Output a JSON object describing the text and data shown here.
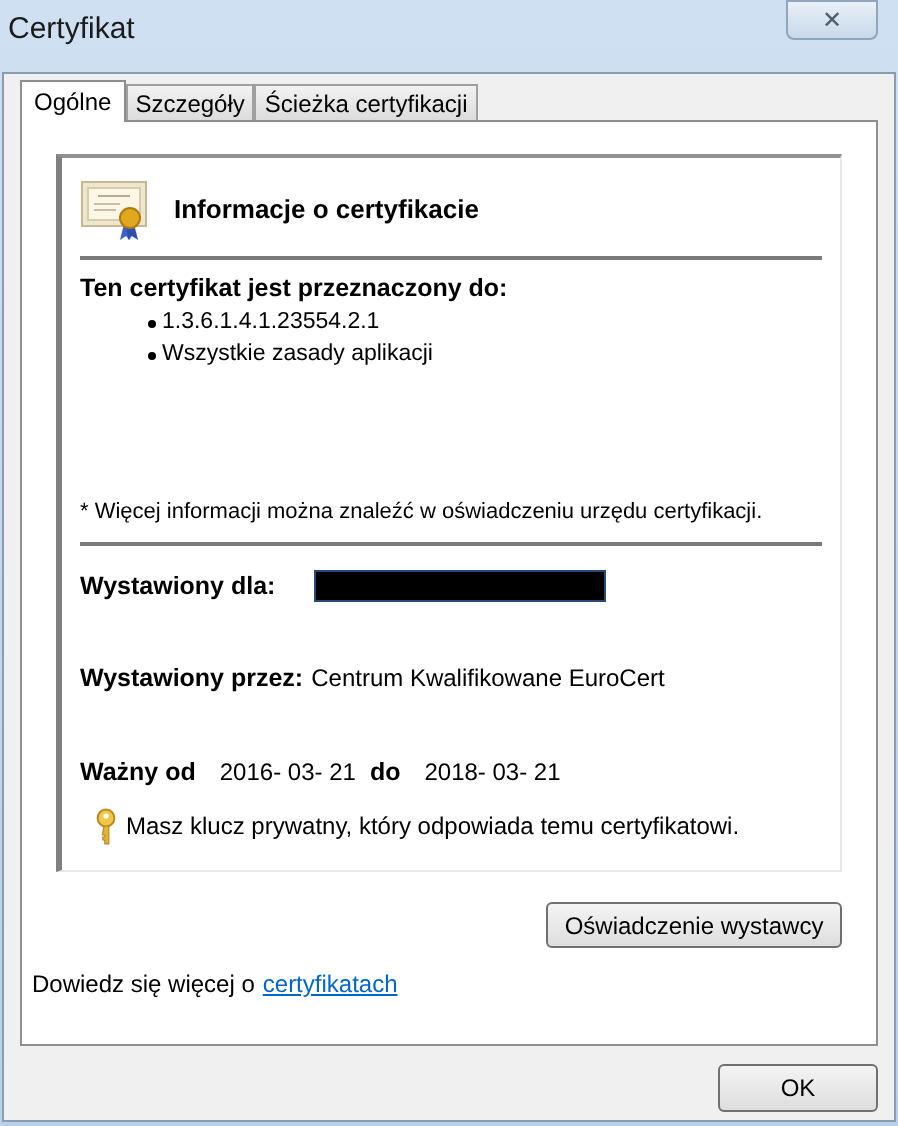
{
  "window": {
    "title": "Certyfikat",
    "close": "✕"
  },
  "tabs": [
    {
      "label": "Ogólne",
      "selected": true
    },
    {
      "label": "Szczegóły",
      "selected": false
    },
    {
      "label": "Ścieżka certyfikacji",
      "selected": false
    }
  ],
  "certificate": {
    "heading": "Informacje o certyfikacie",
    "purpose_title": "Ten certyfikat jest przeznaczony do:",
    "purposes": [
      "1.3.6.1.4.1.23554.2.1",
      "Wszystkie zasady aplikacji"
    ],
    "footnote": "* Więcej informacji można znaleźć w oświadczeniu urzędu certyfikacji.",
    "issued_to": {
      "label": "Wystawiony dla:",
      "redacted": true
    },
    "issued_by": {
      "label": "Wystawiony przez:",
      "value": "Centrum Kwalifikowane EuroCert"
    },
    "validity": {
      "from_label": "Ważny od",
      "from": "2016- 03- 21",
      "to_label": "do",
      "to": "2018- 03- 21"
    },
    "private_key": "Masz klucz prywatny, który odpowiada temu certyfikatowi."
  },
  "issuer_statement_button": "Oświadczenie wystawcy",
  "learn_more": {
    "text": "Dowiedz się więcej o",
    "link": "certyfikatach"
  },
  "buttons": [
    "OK"
  ]
}
